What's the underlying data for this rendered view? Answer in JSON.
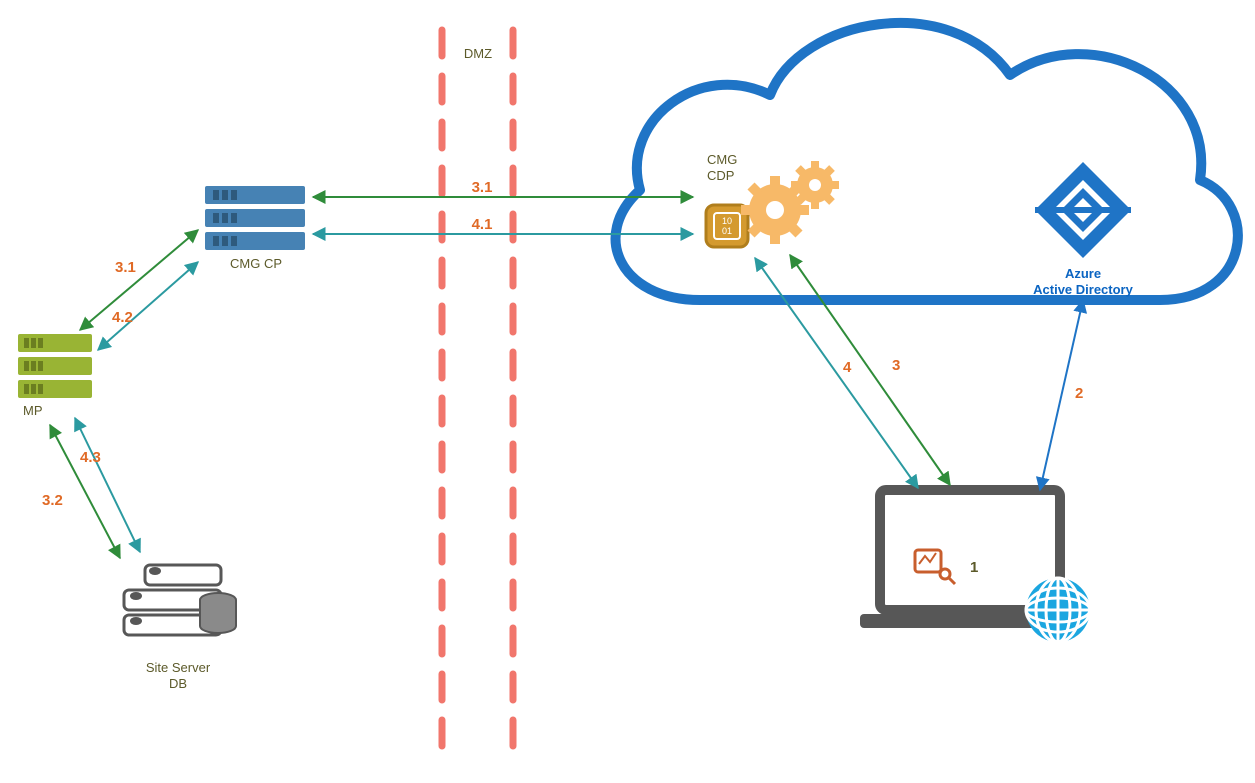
{
  "zones": {
    "dmz": "DMZ"
  },
  "nodes": {
    "cmgcp": "CMG CP",
    "mp": "MP",
    "siteserver_line1": "Site Server",
    "siteserver_line2": "DB",
    "cmg_cdp_line1": "CMG",
    "cmg_cdp_line2": "CDP",
    "azuread_line1": "Azure",
    "azuread_line2": "Active Directory"
  },
  "flows": {
    "f1": "1",
    "f2": "2",
    "f3": "3",
    "f4": "4",
    "f31a": "3.1",
    "f31b": "3.1",
    "f32": "3.2",
    "f41": "4.1",
    "f42": "4.2",
    "f43": "4.3"
  },
  "colors": {
    "cloud": "#1f74c6",
    "dmz_line": "#f1766c",
    "server_blue": "#4682b4",
    "server_green": "#99b434",
    "server_gray": "#6a6a6a",
    "azure_blue": "#1f74c6",
    "gear_orange": "#f7b968",
    "arrow_green": "#2f8c3a",
    "arrow_teal": "#2b9aa0",
    "arrow_blue": "#1f74c6",
    "label_orange": "#e06a26",
    "label_olive": "#5c5a2a",
    "laptop": "#575757",
    "globe": "#1ba6e0"
  }
}
